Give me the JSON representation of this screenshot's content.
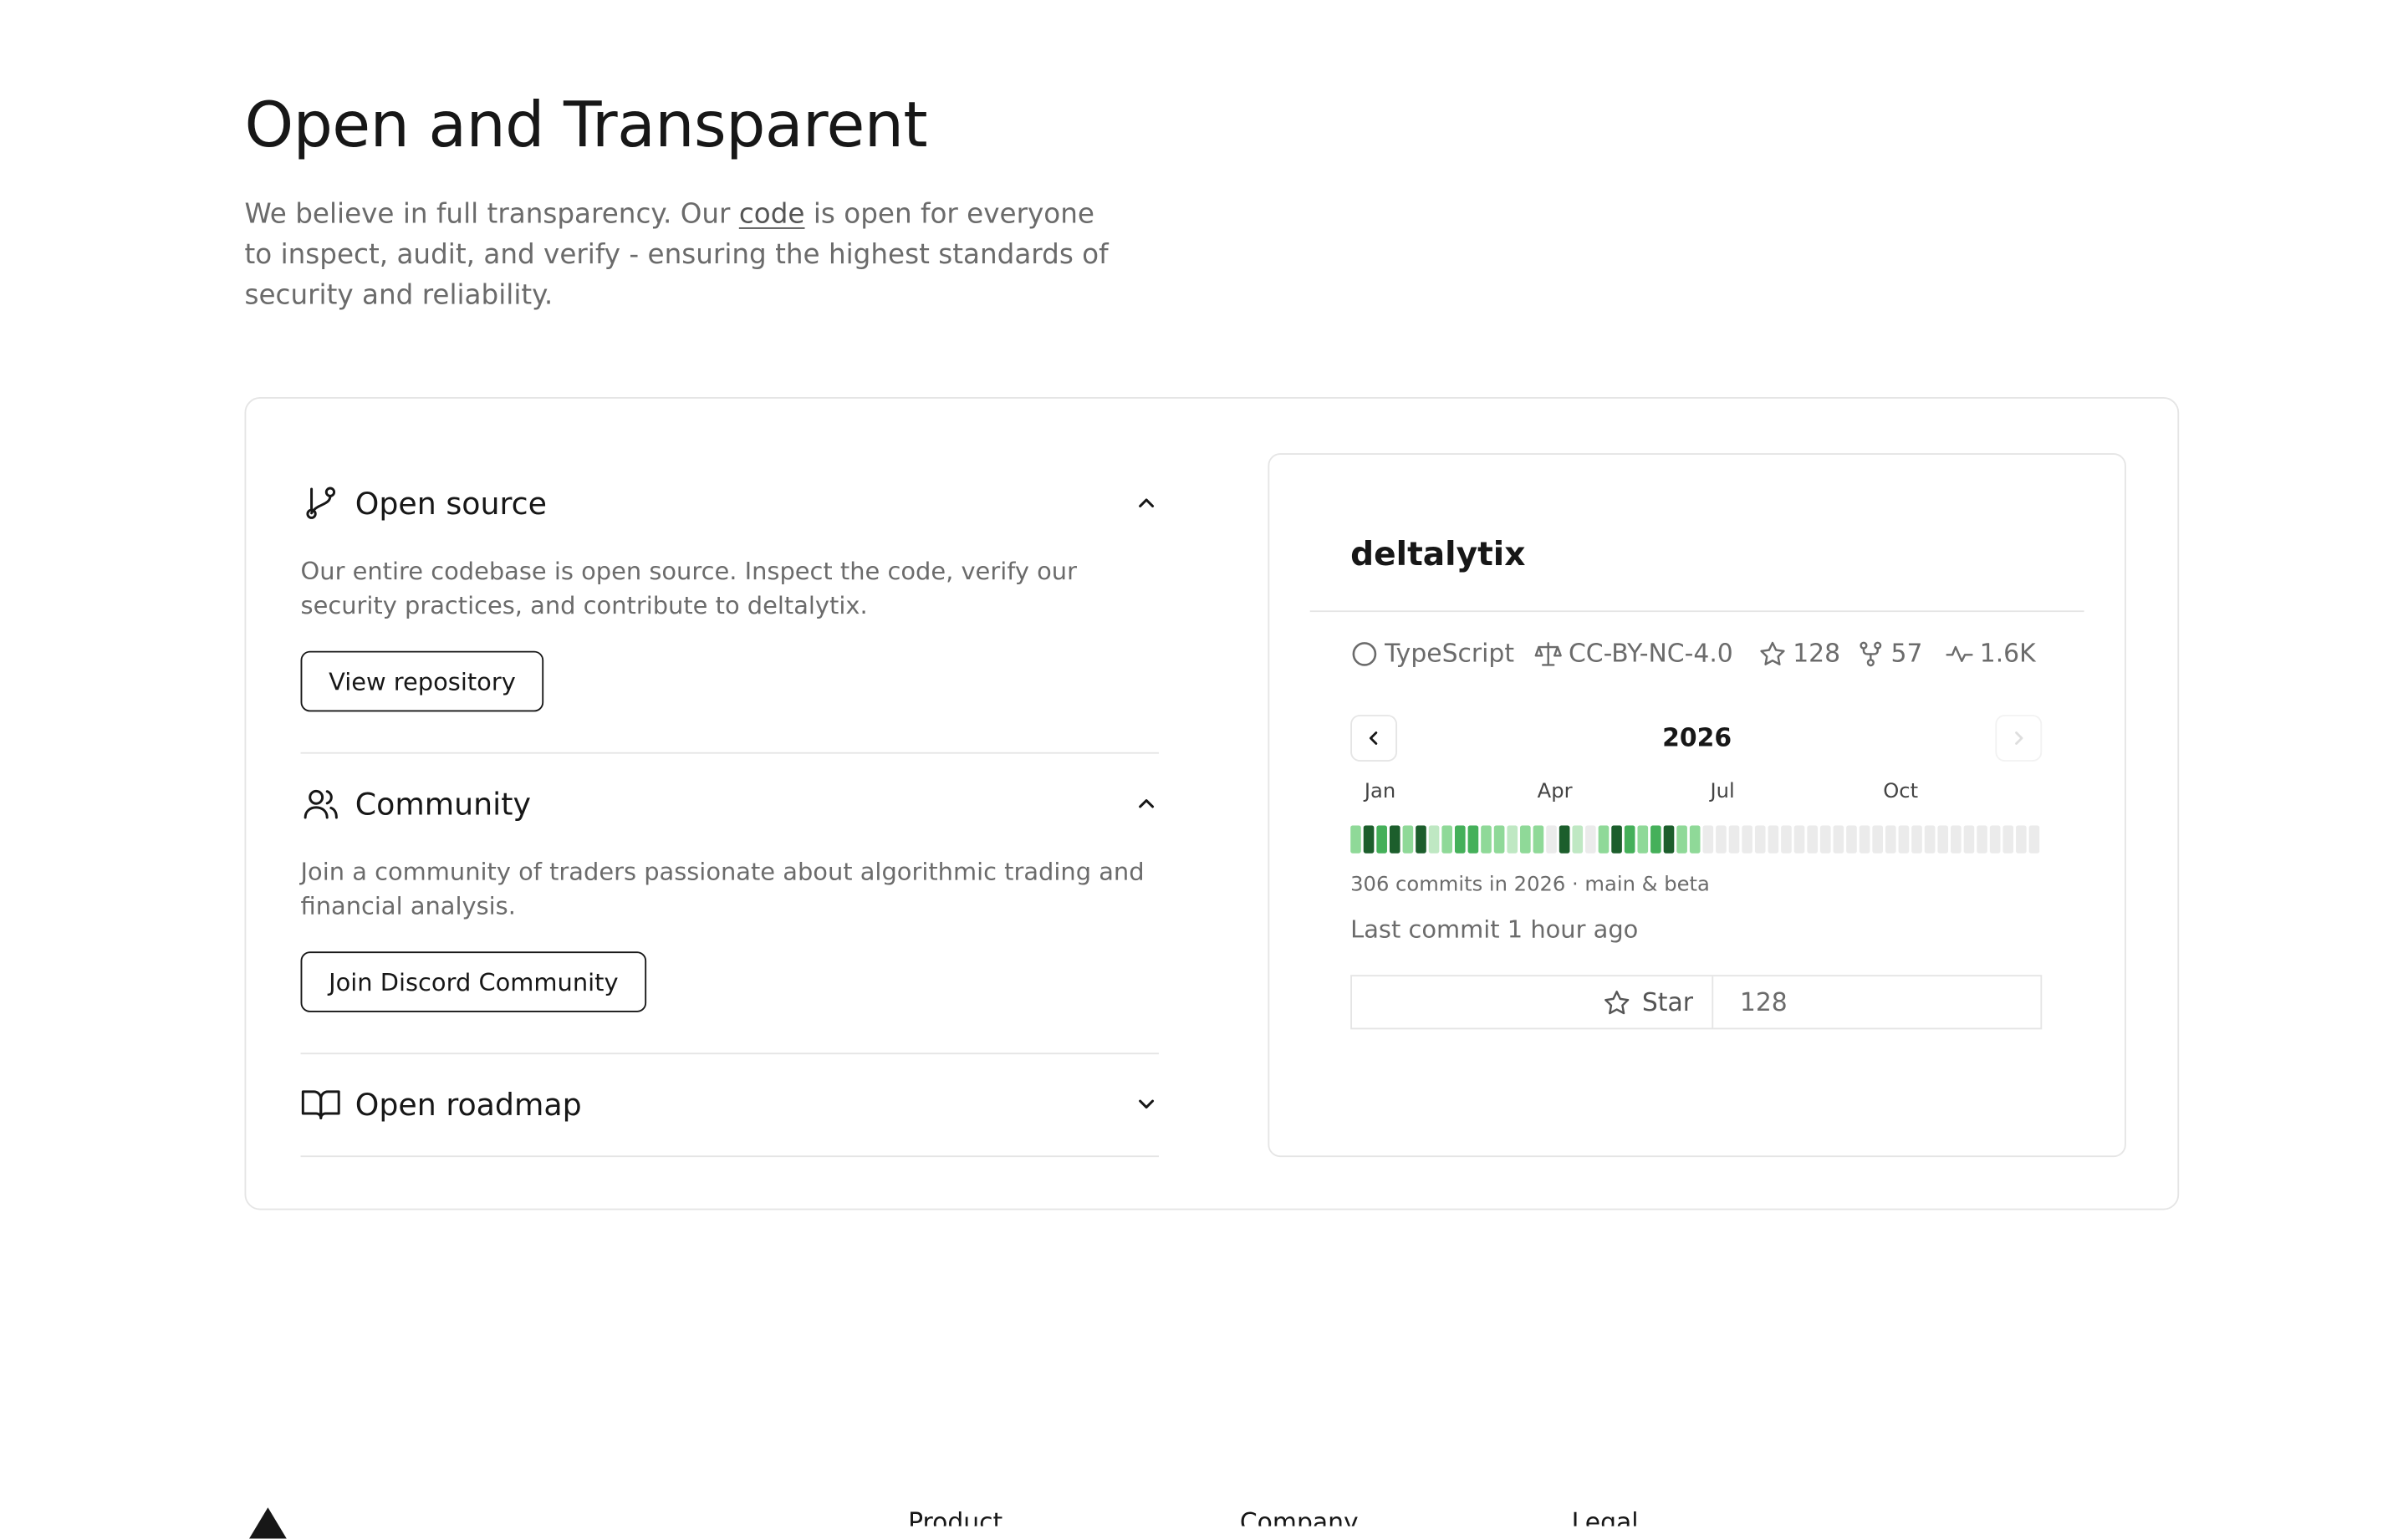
{
  "hero": {
    "title": "Open and Transparent",
    "desc_before": "We believe in full transparency. Our ",
    "code_link": "code",
    "desc_after": " is open for everyone to inspect, audit, and verify - ensuring the highest standards of security and reliability."
  },
  "accordion": [
    {
      "title": "Open source",
      "icon": "git-branch-icon",
      "body": "Our entire codebase is open source. Inspect the code, verify our security practices, and contribute to deltalytix.",
      "button": "View repository",
      "expanded": true
    },
    {
      "title": "Community",
      "icon": "users-icon",
      "body": "Join a community of traders passionate about algorithmic trading and financial analysis.",
      "button": "Join Discord Community",
      "expanded": true
    },
    {
      "title": "Open roadmap",
      "icon": "book-open-icon",
      "expanded": false
    }
  ],
  "repo": {
    "name": "deltalytix",
    "language": "TypeScript",
    "license": "CC-BY-NC-4.0",
    "stars": "128",
    "forks": "57",
    "activity": "1.6K",
    "year": "2026",
    "months": [
      "Jan",
      "Apr",
      "Jul",
      "Oct"
    ],
    "commits_summary": "306 commits in 2026 · main & beta",
    "last_commit": "Last commit 1 hour ago",
    "star_label": "Star",
    "star_count": "128",
    "weekly_activity_levels": [
      2,
      4,
      3,
      4,
      2,
      4,
      1,
      2,
      3,
      3,
      2,
      2,
      1,
      2,
      2,
      0,
      4,
      1,
      0,
      2,
      4,
      3,
      2,
      3,
      4,
      2,
      2,
      0,
      0,
      0,
      0,
      0,
      0,
      0,
      0,
      0,
      0,
      0,
      0,
      0,
      0,
      0,
      0,
      0,
      0,
      0,
      0,
      0,
      0,
      0,
      0,
      0,
      0
    ],
    "colors": {
      "level_0": "#ebebeb",
      "level_1": "#bfe8c3",
      "level_2": "#8fd998",
      "level_3": "#45b05a",
      "level_4": "#1c5e2c"
    }
  },
  "footer": {
    "fragments": [
      "Product",
      "Company",
      "Legal"
    ]
  }
}
